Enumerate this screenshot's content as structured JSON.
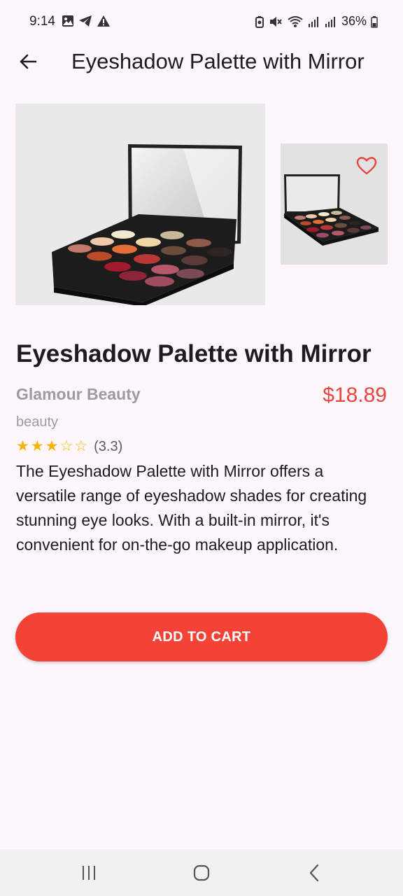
{
  "status_bar": {
    "time": "9:14",
    "battery": "36%",
    "left_icons": [
      "image-icon",
      "telegram-icon",
      "alert-icon"
    ],
    "right_icons": [
      "battery-saver-icon",
      "mute-icon",
      "wifi-icon",
      "signal-icon",
      "signal-icon",
      "battery-icon"
    ]
  },
  "app_bar": {
    "title": "Eyeshadow Palette with Mirror"
  },
  "product": {
    "name": "Eyeshadow Palette with Mirror",
    "brand": "Glamour Beauty",
    "price": "$18.89",
    "category": "beauty",
    "rating": {
      "stars_filled": 3,
      "stars_total": 5,
      "value_label": "(3.3)"
    },
    "description": "The Eyeshadow Palette with Mirror offers a versatile range of eyeshadow shades for creating stunning eye looks. With a built-in mirror, it's convenient for on-the-go makeup application."
  },
  "actions": {
    "add_to_cart_label": "ADD TO CART"
  },
  "colors": {
    "accent": "#f44336",
    "price": "#e8453c",
    "star": "#f5b400",
    "background": "#fdf7fd"
  }
}
